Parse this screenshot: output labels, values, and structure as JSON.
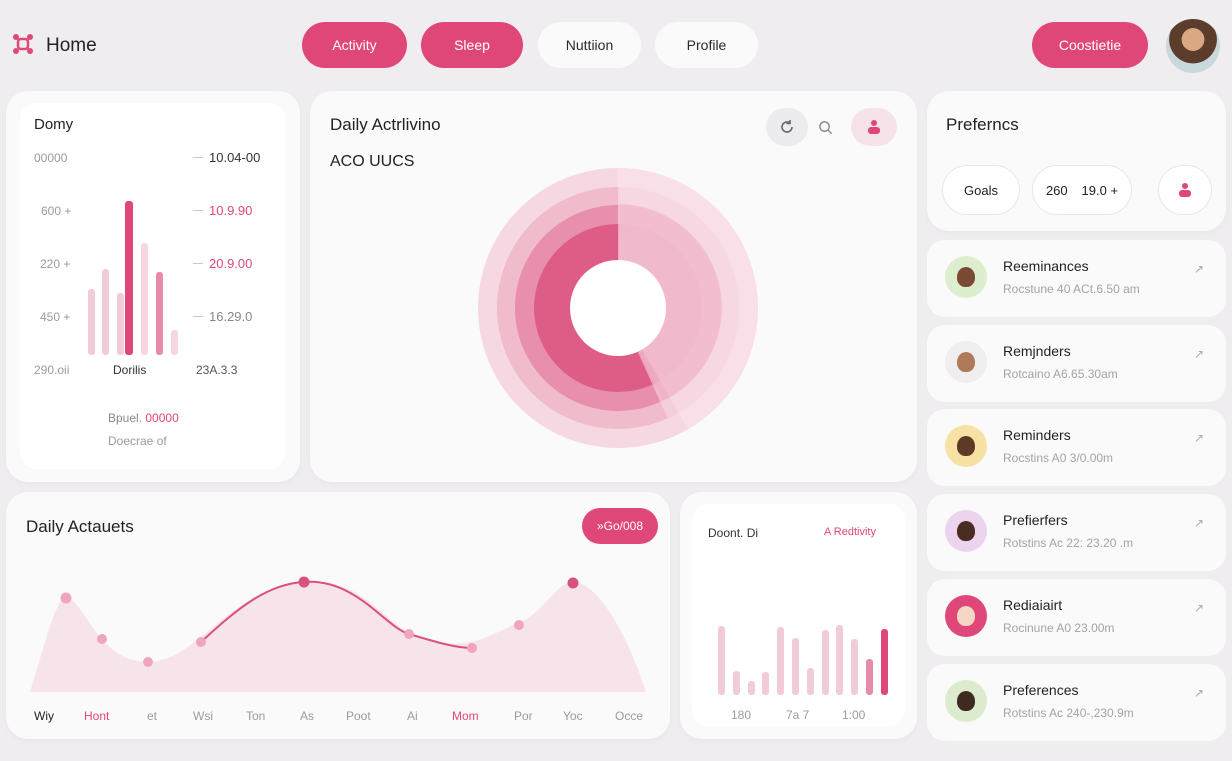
{
  "header": {
    "home_label": "Home",
    "nav": [
      {
        "label": "Activity",
        "active": true
      },
      {
        "label": "Sleep",
        "active": true
      },
      {
        "label": "Nuttiion",
        "active": false
      },
      {
        "label": "Profile",
        "active": false
      }
    ],
    "cta_label": "Coostietie",
    "accent_color": "#e04779"
  },
  "stats_card": {
    "title": "Domy",
    "y_labels": [
      "00000",
      "600 +",
      "220 +",
      "450 +",
      "290.oii"
    ],
    "right_labels": [
      "10.04-00",
      "10.9.90",
      "20.9.00",
      "16.29.0"
    ],
    "x_center_label": "Dorilis",
    "x_right_label": "23A.3.3",
    "footer_line1_prefix": "Bpuel.",
    "footer_line1_value": "00000",
    "footer_line2": "Doecrae of",
    "bars": [
      {
        "value": 0.43,
        "color": "#f2cbd8"
      },
      {
        "value": 0.56,
        "color": "#f2cbd8"
      },
      {
        "value": 0.4,
        "color": "#f2cbd8"
      },
      {
        "value": 1.0,
        "color": "#e04779"
      },
      {
        "value": 0.73,
        "color": "#f6d6e1"
      },
      {
        "value": 0.54,
        "color": "#e88aaa"
      },
      {
        "value": 0.16,
        "color": "#f6d6e1"
      }
    ]
  },
  "donut_card": {
    "title": "Daily Actrlivino",
    "subtitle": "ACO UUCS",
    "icons": [
      "refresh-icon",
      "search-icon",
      "people-icon"
    ]
  },
  "prefs_card": {
    "title": "Preferncs",
    "goals_label": "Goals",
    "value_a": "260",
    "value_b": "19.0 +"
  },
  "list": [
    {
      "title": "Reeminances",
      "subtitle": "Rocstune 40 ACt.6.50 am",
      "avatar_bg": "#dceecd"
    },
    {
      "title": "Remjnders",
      "subtitle": "Rotcaino A6.65.30am",
      "avatar_bg": "#f0eeee"
    },
    {
      "title": "Reminders",
      "subtitle": "Rocstins A0 3/0.00m",
      "avatar_bg": "#f7e1a4"
    },
    {
      "title": "Prefierfers",
      "subtitle": "Rotstins Ac 22: 23.20 .m",
      "avatar_bg": "#ecd4ef"
    },
    {
      "title": "Rediaiairt",
      "subtitle": "Rocinune A0 23.00m",
      "avatar_bg": "#e04779"
    },
    {
      "title": "Preferences",
      "subtitle": "Rotstins Ac 240-,230.9m",
      "avatar_bg": "#dcebcd"
    }
  ],
  "line_card": {
    "title": "Daily Actauets",
    "button_label": "»Go/008",
    "x_labels": [
      {
        "text": "Wiy",
        "style": "dark"
      },
      {
        "text": "Hont",
        "style": "pink"
      },
      {
        "text": "et",
        "style": "grey"
      },
      {
        "text": "Wsi",
        "style": "grey"
      },
      {
        "text": "Ton",
        "style": "grey"
      },
      {
        "text": "As",
        "style": "grey"
      },
      {
        "text": "Poot",
        "style": "grey"
      },
      {
        "text": "Ai",
        "style": "grey"
      },
      {
        "text": "Mom",
        "style": "pink"
      },
      {
        "text": "Por",
        "style": "grey"
      },
      {
        "text": "Yoc",
        "style": "grey"
      },
      {
        "text": "Occe",
        "style": "grey"
      }
    ]
  },
  "bar_card": {
    "title": "Doont. Di",
    "link_label": "A Redtivity",
    "x_labels": [
      "180",
      "7a 7",
      "1:00"
    ],
    "bars": [
      0.77,
      0.27,
      0.15,
      0.25,
      0.75,
      0.63,
      0.3,
      0.72,
      0.78,
      0.62,
      0.4,
      0.73
    ]
  }
}
